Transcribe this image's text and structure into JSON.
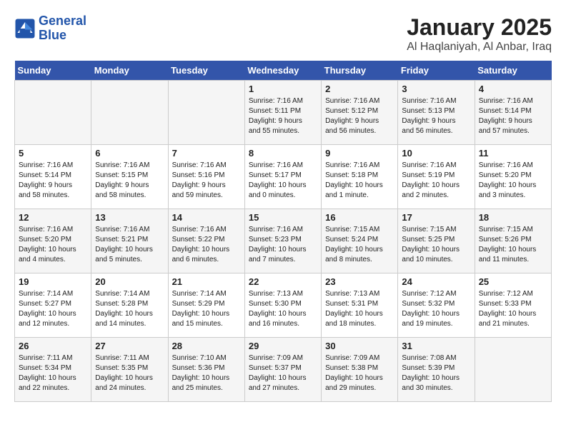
{
  "header": {
    "logo_line1": "General",
    "logo_line2": "Blue",
    "title": "January 2025",
    "subtitle": "Al Haqlaniyah, Al Anbar, Iraq"
  },
  "days_of_week": [
    "Sunday",
    "Monday",
    "Tuesday",
    "Wednesday",
    "Thursday",
    "Friday",
    "Saturday"
  ],
  "weeks": [
    [
      {
        "day": "",
        "info": ""
      },
      {
        "day": "",
        "info": ""
      },
      {
        "day": "",
        "info": ""
      },
      {
        "day": "1",
        "info": "Sunrise: 7:16 AM\nSunset: 5:11 PM\nDaylight: 9 hours\nand 55 minutes."
      },
      {
        "day": "2",
        "info": "Sunrise: 7:16 AM\nSunset: 5:12 PM\nDaylight: 9 hours\nand 56 minutes."
      },
      {
        "day": "3",
        "info": "Sunrise: 7:16 AM\nSunset: 5:13 PM\nDaylight: 9 hours\nand 56 minutes."
      },
      {
        "day": "4",
        "info": "Sunrise: 7:16 AM\nSunset: 5:14 PM\nDaylight: 9 hours\nand 57 minutes."
      }
    ],
    [
      {
        "day": "5",
        "info": "Sunrise: 7:16 AM\nSunset: 5:14 PM\nDaylight: 9 hours\nand 58 minutes."
      },
      {
        "day": "6",
        "info": "Sunrise: 7:16 AM\nSunset: 5:15 PM\nDaylight: 9 hours\nand 58 minutes."
      },
      {
        "day": "7",
        "info": "Sunrise: 7:16 AM\nSunset: 5:16 PM\nDaylight: 9 hours\nand 59 minutes."
      },
      {
        "day": "8",
        "info": "Sunrise: 7:16 AM\nSunset: 5:17 PM\nDaylight: 10 hours\nand 0 minutes."
      },
      {
        "day": "9",
        "info": "Sunrise: 7:16 AM\nSunset: 5:18 PM\nDaylight: 10 hours\nand 1 minute."
      },
      {
        "day": "10",
        "info": "Sunrise: 7:16 AM\nSunset: 5:19 PM\nDaylight: 10 hours\nand 2 minutes."
      },
      {
        "day": "11",
        "info": "Sunrise: 7:16 AM\nSunset: 5:20 PM\nDaylight: 10 hours\nand 3 minutes."
      }
    ],
    [
      {
        "day": "12",
        "info": "Sunrise: 7:16 AM\nSunset: 5:20 PM\nDaylight: 10 hours\nand 4 minutes."
      },
      {
        "day": "13",
        "info": "Sunrise: 7:16 AM\nSunset: 5:21 PM\nDaylight: 10 hours\nand 5 minutes."
      },
      {
        "day": "14",
        "info": "Sunrise: 7:16 AM\nSunset: 5:22 PM\nDaylight: 10 hours\nand 6 minutes."
      },
      {
        "day": "15",
        "info": "Sunrise: 7:16 AM\nSunset: 5:23 PM\nDaylight: 10 hours\nand 7 minutes."
      },
      {
        "day": "16",
        "info": "Sunrise: 7:15 AM\nSunset: 5:24 PM\nDaylight: 10 hours\nand 8 minutes."
      },
      {
        "day": "17",
        "info": "Sunrise: 7:15 AM\nSunset: 5:25 PM\nDaylight: 10 hours\nand 10 minutes."
      },
      {
        "day": "18",
        "info": "Sunrise: 7:15 AM\nSunset: 5:26 PM\nDaylight: 10 hours\nand 11 minutes."
      }
    ],
    [
      {
        "day": "19",
        "info": "Sunrise: 7:14 AM\nSunset: 5:27 PM\nDaylight: 10 hours\nand 12 minutes."
      },
      {
        "day": "20",
        "info": "Sunrise: 7:14 AM\nSunset: 5:28 PM\nDaylight: 10 hours\nand 14 minutes."
      },
      {
        "day": "21",
        "info": "Sunrise: 7:14 AM\nSunset: 5:29 PM\nDaylight: 10 hours\nand 15 minutes."
      },
      {
        "day": "22",
        "info": "Sunrise: 7:13 AM\nSunset: 5:30 PM\nDaylight: 10 hours\nand 16 minutes."
      },
      {
        "day": "23",
        "info": "Sunrise: 7:13 AM\nSunset: 5:31 PM\nDaylight: 10 hours\nand 18 minutes."
      },
      {
        "day": "24",
        "info": "Sunrise: 7:12 AM\nSunset: 5:32 PM\nDaylight: 10 hours\nand 19 minutes."
      },
      {
        "day": "25",
        "info": "Sunrise: 7:12 AM\nSunset: 5:33 PM\nDaylight: 10 hours\nand 21 minutes."
      }
    ],
    [
      {
        "day": "26",
        "info": "Sunrise: 7:11 AM\nSunset: 5:34 PM\nDaylight: 10 hours\nand 22 minutes."
      },
      {
        "day": "27",
        "info": "Sunrise: 7:11 AM\nSunset: 5:35 PM\nDaylight: 10 hours\nand 24 minutes."
      },
      {
        "day": "28",
        "info": "Sunrise: 7:10 AM\nSunset: 5:36 PM\nDaylight: 10 hours\nand 25 minutes."
      },
      {
        "day": "29",
        "info": "Sunrise: 7:09 AM\nSunset: 5:37 PM\nDaylight: 10 hours\nand 27 minutes."
      },
      {
        "day": "30",
        "info": "Sunrise: 7:09 AM\nSunset: 5:38 PM\nDaylight: 10 hours\nand 29 minutes."
      },
      {
        "day": "31",
        "info": "Sunrise: 7:08 AM\nSunset: 5:39 PM\nDaylight: 10 hours\nand 30 minutes."
      },
      {
        "day": "",
        "info": ""
      }
    ]
  ]
}
